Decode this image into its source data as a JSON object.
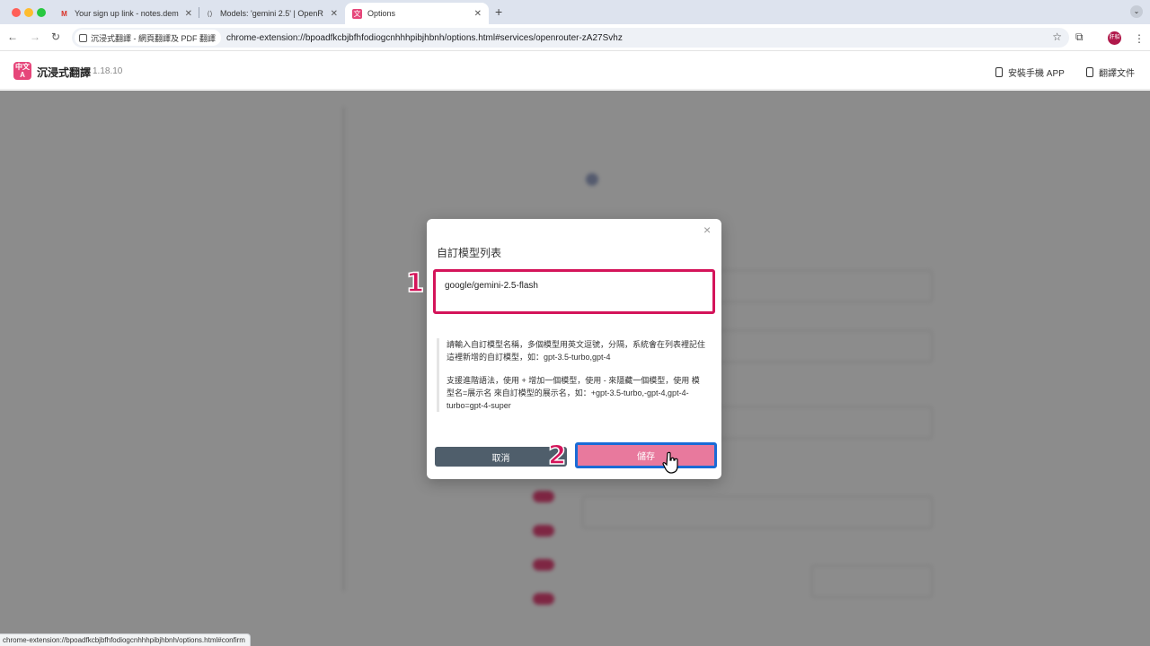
{
  "browser": {
    "tabs": [
      {
        "title": "Your sign up link - notes.dem",
        "icon": "gmail-icon",
        "active": false
      },
      {
        "title": "Models: 'gemini 2.5' | OpenR",
        "icon": "openrouter-icon",
        "active": false
      },
      {
        "title": "Options",
        "icon": "immersive-translate-icon",
        "active": true
      }
    ],
    "new_tab": "+",
    "extension_chip": "沉浸式翻譯 - 網頁翻譯及 PDF 翻譯",
    "url": "chrome-extension://bpoadfkcbjbfhfodiogcnhhhpibjhbnh/options.html#services/openrouter-zA27Svhz",
    "status_url": "chrome-extension://bpoadfkcbjbfhfodiogcnhhhpibjhbnh/options.html#confirm",
    "avatar_text": "肝船"
  },
  "app": {
    "logo_text": "中文A",
    "name": "沉浸式翻譯",
    "version": "1.18.10",
    "header_links": [
      "安裝手機 APP",
      "翻譯文件"
    ]
  },
  "modal": {
    "title": "自訂模型列表",
    "input_value": "google/gemini-2.5-flash",
    "hint_1": "請輸入自訂模型名稱，多個模型用英文逗號，分隔，系統會在列表裡記住這裡新增的自訂模型，如：gpt-3.5-turbo,gpt-4",
    "hint_2": "支援進階語法，使用 + 增加一個模型，使用 - 來隱藏一個模型，使用 模型名=展示名 來自訂模型的展示名，如：+gpt-3.5-turbo,-gpt-4,gpt-4-turbo=gpt-4-super",
    "cancel_label": "取消",
    "save_label": "儲存",
    "close_label": "×"
  },
  "steps": {
    "step1": "1",
    "step2": "2"
  },
  "colors": {
    "accent": "#e6467a",
    "highlight_red": "#d4145a",
    "highlight_blue": "#1a6bd6"
  }
}
